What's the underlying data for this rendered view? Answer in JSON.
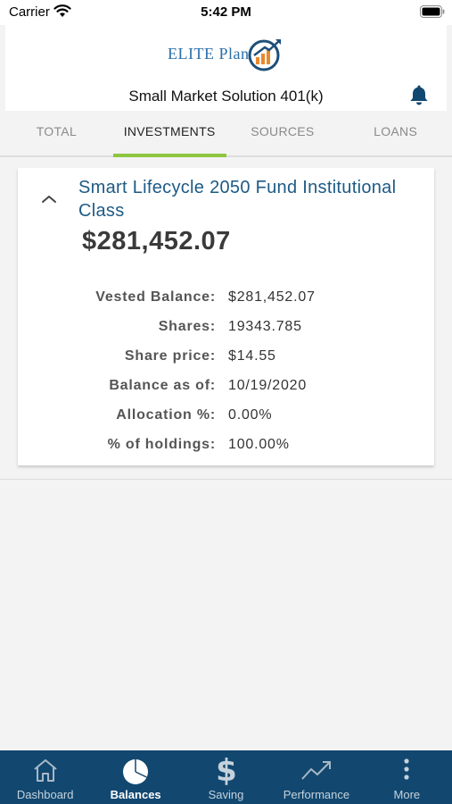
{
  "status_bar": {
    "carrier": "Carrier",
    "time": "5:42 PM"
  },
  "header": {
    "logo_text": "ELITE Plan",
    "plan_name": "Small Market Solution 401(k)"
  },
  "tabs": [
    {
      "label": "TOTAL",
      "active": false
    },
    {
      "label": "INVESTMENTS",
      "active": true
    },
    {
      "label": "SOURCES",
      "active": false
    },
    {
      "label": "LOANS",
      "active": false
    }
  ],
  "fund": {
    "name": "Smart Lifecycle 2050 Fund Institutional Class",
    "balance": "$281,452.07",
    "details": [
      {
        "label": "Vested Balance:",
        "value": "$281,452.07"
      },
      {
        "label": "Shares:",
        "value": "19343.785"
      },
      {
        "label": "Share price:",
        "value": "$14.55"
      },
      {
        "label": "Balance as of:",
        "value": "10/19/2020"
      },
      {
        "label": "Allocation %:",
        "value": "0.00%"
      },
      {
        "label": "% of holdings:",
        "value": "100.00%"
      }
    ]
  },
  "bottom_nav": [
    {
      "label": "Dashboard",
      "icon": "house-icon",
      "active": false
    },
    {
      "label": "Balances",
      "icon": "pie-chart-icon",
      "active": true
    },
    {
      "label": "Saving",
      "icon": "dollar-icon",
      "active": false
    },
    {
      "label": "Performance",
      "icon": "trend-icon",
      "active": false
    },
    {
      "label": "More",
      "icon": "more-vertical-icon",
      "active": false
    }
  ],
  "colors": {
    "brand_blue": "#124870",
    "fund_title": "#1d5a85",
    "active_tab_underline": "#8dc63f",
    "logo_accent": "#e98a2e"
  }
}
